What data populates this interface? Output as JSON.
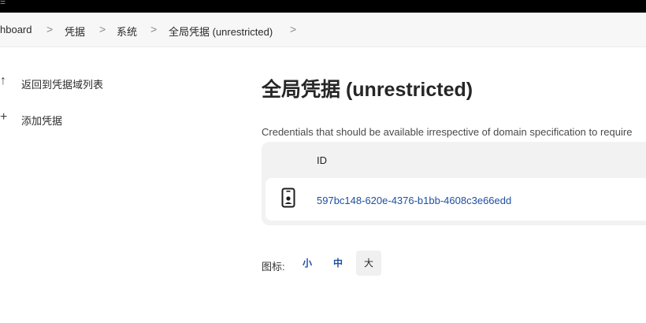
{
  "topbar": {
    "glyph": "="
  },
  "breadcrumb": {
    "items": [
      {
        "label": "hboard"
      },
      {
        "label": "凭据"
      },
      {
        "label": "系统"
      },
      {
        "label": "全局凭据 (unrestricted)"
      }
    ],
    "separator": ">"
  },
  "sidebar": {
    "items": [
      {
        "label": "返回到凭据域列表",
        "icon": "arrow-up-icon",
        "glyph": "↑"
      },
      {
        "label": "添加凭据",
        "icon": "plus-icon",
        "glyph": "+"
      }
    ]
  },
  "main": {
    "title": "全局凭据 (unrestricted)",
    "description": "Credentials that should be available irrespective of domain specification to require",
    "table": {
      "columns": [
        "ID"
      ],
      "rows": [
        {
          "icon": "phone-badge-icon",
          "id": "597bc148-620e-4376-b1bb-4608c3e66edd"
        }
      ]
    },
    "icon_size": {
      "label": "图标:",
      "options": [
        "小",
        "中",
        "大"
      ],
      "selected": "大"
    }
  },
  "colors": {
    "link": "#1f4fa0",
    "breadcrumb_bg": "#f7f7f8",
    "table_bg": "#f2f2f3",
    "topbar": "#000000"
  }
}
